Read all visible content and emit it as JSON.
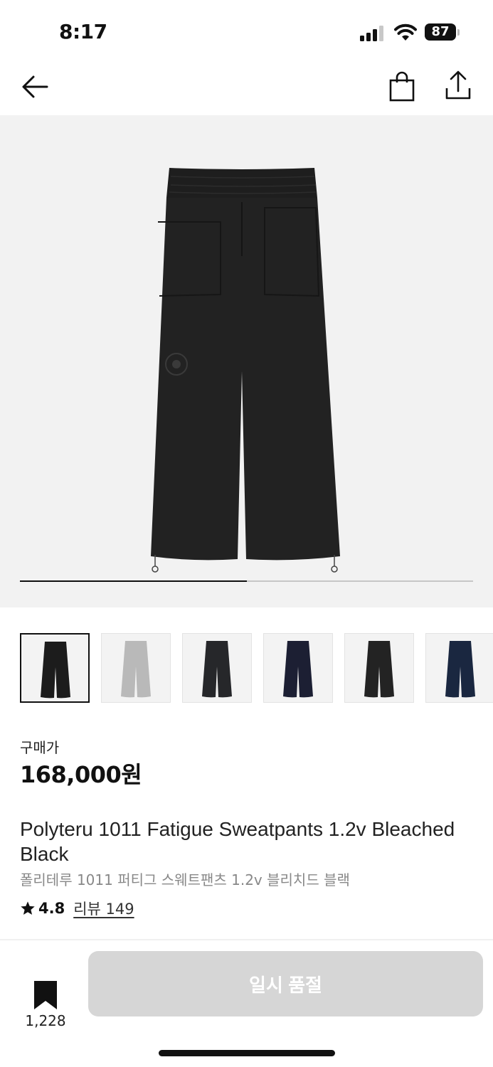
{
  "status_bar": {
    "time": "8:17",
    "battery_level": "87",
    "icons": [
      "cellular-signal-icon",
      "wifi-icon",
      "battery-icon"
    ]
  },
  "nav": {
    "icons": [
      "back-arrow-icon",
      "shopping-bag-icon",
      "share-icon"
    ]
  },
  "gallery": {
    "progress": 0.5,
    "thumbnails": [
      {
        "color": "#1c1c1c",
        "selected": true
      },
      {
        "color": "#b9b9b9",
        "selected": false
      },
      {
        "color": "#26272a",
        "selected": false
      },
      {
        "color": "#1c1f33",
        "selected": false
      },
      {
        "color": "#232323",
        "selected": false
      },
      {
        "color": "#1a2740",
        "selected": false
      }
    ]
  },
  "product": {
    "price_label": "구매가",
    "price": "168,000원",
    "title_en": "Polyteru 1011 Fatigue Sweatpants 1.2v Bleached Black",
    "title_ko": "폴리테루 1011 퍼티그 스웨트팬츠 1.2v 블리치드 블랙",
    "rating": "4.8",
    "reviews_label": "리뷰 149"
  },
  "bottom_bar": {
    "bookmark_count": "1,228",
    "buy_button_label": "일시 품절"
  },
  "colors": {
    "accent": "#111111",
    "image_background": "#f2f2f2",
    "disabled_button": "#d6d6d6",
    "subtle_text": "#888888"
  }
}
